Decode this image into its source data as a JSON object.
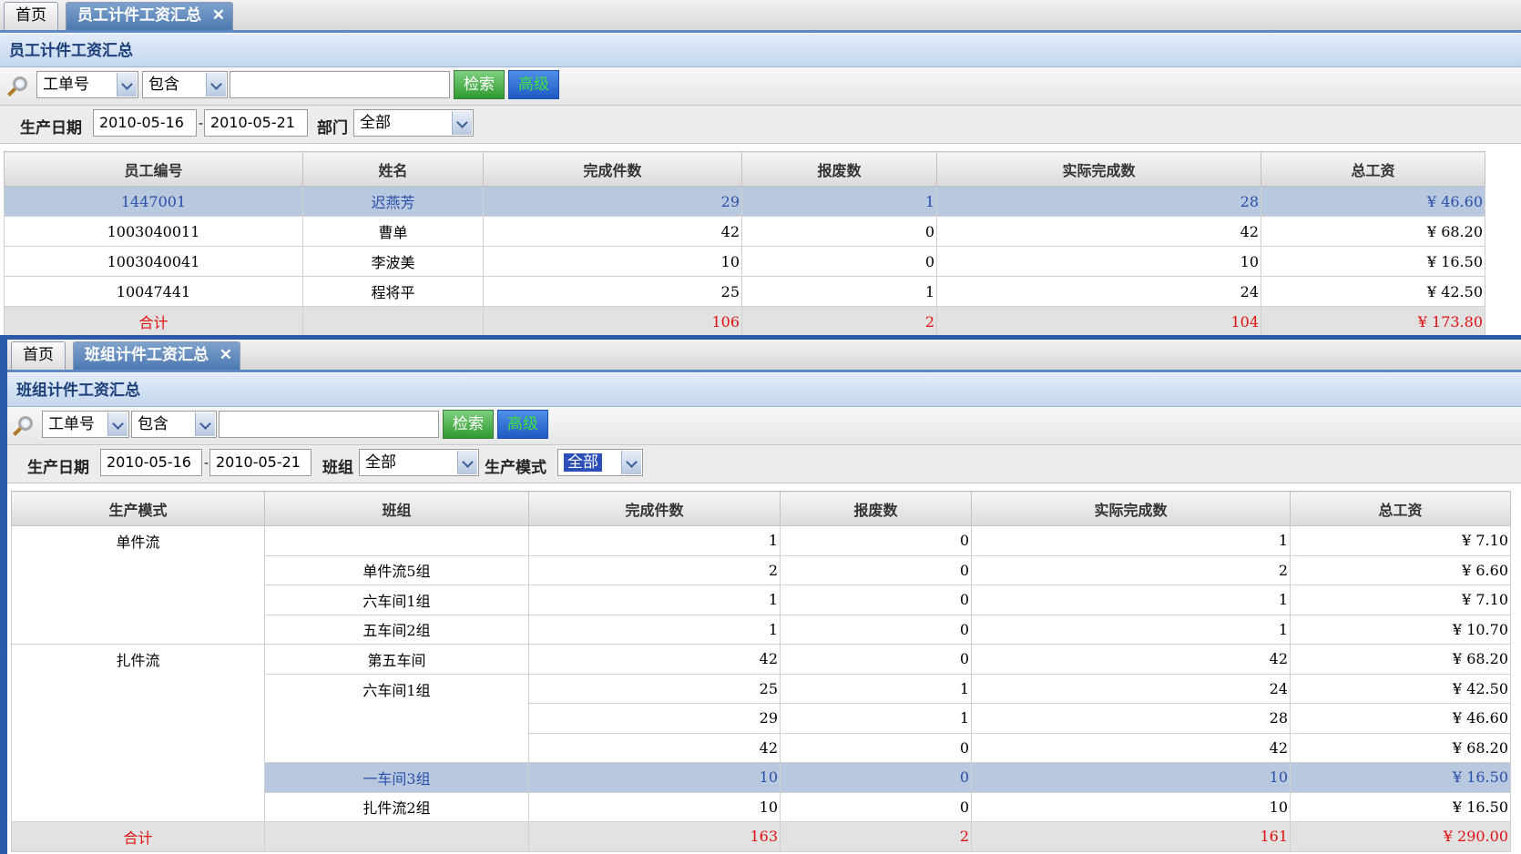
{
  "panel_a": {
    "tabs": [
      {
        "label": "首页"
      },
      {
        "label": "员工计件工资汇总"
      }
    ],
    "title": "员工计件工资汇总",
    "search": {
      "field": "工单号",
      "operator": "包含",
      "value": "",
      "search_button": "检索",
      "advanced_button": "高级"
    },
    "filters": {
      "date_label": "生产日期",
      "date_from": "2010-05-16",
      "date_to": "2010-05-21",
      "dept_label": "部门",
      "dept_value": "全部"
    },
    "table": {
      "columns": [
        "员工编号",
        "姓名",
        "完成件数",
        "报废数",
        "实际完成数",
        "总工资"
      ],
      "rows": [
        [
          "1447001",
          "迟燕芳",
          "29",
          "1",
          "28",
          "¥ 46.60"
        ],
        [
          "1003040011",
          "曹单",
          "42",
          "0",
          "42",
          "¥ 68.20"
        ],
        [
          "1003040041",
          "李波美",
          "10",
          "0",
          "10",
          "¥ 16.50"
        ],
        [
          "10047441",
          "程将平",
          "25",
          "1",
          "24",
          "¥ 42.50"
        ]
      ],
      "total": [
        "合计",
        "",
        "106",
        "2",
        "104",
        "¥ 173.80"
      ]
    }
  },
  "panel_b": {
    "tabs": [
      {
        "label": "首页"
      },
      {
        "label": "班组计件工资汇总"
      }
    ],
    "title": "班组计件工资汇总",
    "search": {
      "field": "工单号",
      "operator": "包含",
      "value": "",
      "search_button": "检索",
      "advanced_button": "高级"
    },
    "filters": {
      "date_label": "生产日期",
      "date_from": "2010-05-16",
      "date_to": "2010-05-21",
      "team_label": "班组",
      "team_value": "全部",
      "mode_label": "生产模式",
      "mode_value": "全部"
    },
    "table": {
      "columns": [
        "生产模式",
        "班组",
        "完成件数",
        "报废数",
        "实际完成数",
        "总工资"
      ],
      "groups": [
        {
          "mode": "单件流"
        },
        {
          "mode": "扎件流"
        }
      ],
      "rows": [
        {
          "team": "",
          "done": "1",
          "scrap": "0",
          "actual": "1",
          "pay": "¥ 7.10"
        },
        {
          "team": "单件流5组",
          "done": "2",
          "scrap": "0",
          "actual": "2",
          "pay": "¥ 6.60"
        },
        {
          "team": "六车间1组",
          "done": "1",
          "scrap": "0",
          "actual": "1",
          "pay": "¥ 7.10"
        },
        {
          "team": "五车间2组",
          "done": "1",
          "scrap": "0",
          "actual": "1",
          "pay": "¥ 10.70"
        },
        {
          "team": "第五车间",
          "done": "42",
          "scrap": "0",
          "actual": "42",
          "pay": "¥ 68.20"
        },
        {
          "team": "六车间1组",
          "done": "25",
          "scrap": "1",
          "actual": "24",
          "pay": "¥ 42.50"
        },
        {
          "team": "",
          "done": "29",
          "scrap": "1",
          "actual": "28",
          "pay": "¥ 46.60"
        },
        {
          "team": "",
          "done": "42",
          "scrap": "0",
          "actual": "42",
          "pay": "¥ 68.20"
        },
        {
          "team": "一车间3组",
          "done": "10",
          "scrap": "0",
          "actual": "10",
          "pay": "¥ 16.50"
        },
        {
          "team": "扎件流2组",
          "done": "10",
          "scrap": "0",
          "actual": "10",
          "pay": "¥ 16.50"
        }
      ],
      "total": [
        "合计",
        "",
        "163",
        "2",
        "161",
        "¥ 290.00"
      ]
    }
  }
}
